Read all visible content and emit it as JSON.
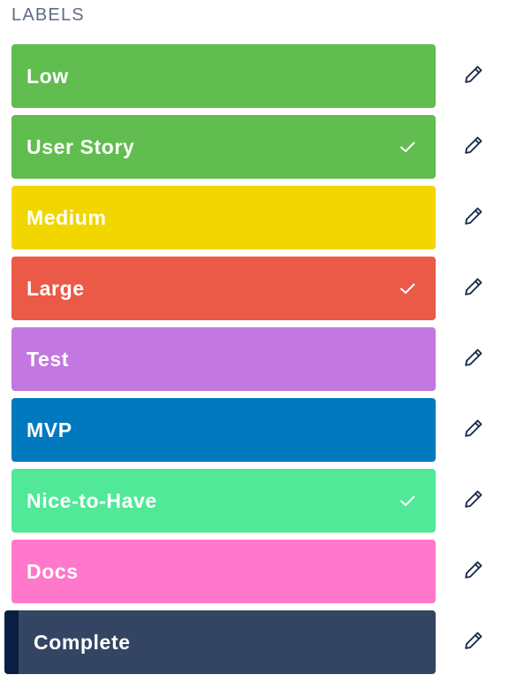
{
  "header": {
    "title": "LABELS"
  },
  "labels": [
    {
      "name": "Low",
      "color": "#61bd4f",
      "checked": false
    },
    {
      "name": "User Story",
      "color": "#61bd4f",
      "checked": true
    },
    {
      "name": "Medium",
      "color": "#f2d600",
      "checked": false
    },
    {
      "name": "Large",
      "color": "#eb5a46",
      "checked": true
    },
    {
      "name": "Test",
      "color": "#c377e0",
      "checked": false
    },
    {
      "name": "MVP",
      "color": "#0079bf",
      "checked": false
    },
    {
      "name": "Nice-to-Have",
      "color": "#51e898",
      "checked": true
    },
    {
      "name": "Docs",
      "color": "#ff78cb",
      "checked": false
    },
    {
      "name": "Complete",
      "color": "#344563",
      "checked": false,
      "focused": true
    }
  ],
  "icons": {
    "check": "check-icon",
    "edit": "pencil-icon"
  }
}
